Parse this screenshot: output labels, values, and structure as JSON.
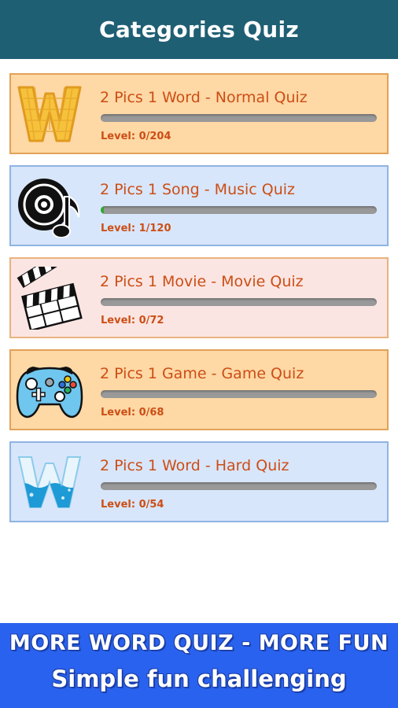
{
  "header": {
    "title": "Categories Quiz"
  },
  "categories": [
    {
      "title": "2 Pics 1 Word - Normal Quiz",
      "level": "Level: 0/204",
      "progress": 0.0,
      "theme": "orange",
      "icon": "waffle-w-icon"
    },
    {
      "title": "2 Pics 1 Song - Music Quiz",
      "level": "Level: 1/120",
      "progress": 0.0083,
      "theme": "blue",
      "icon": "vinyl-music-icon"
    },
    {
      "title": "2 Pics 1 Movie - Movie Quiz",
      "level": "Level: 0/72",
      "progress": 0.0,
      "theme": "pink",
      "icon": "clapperboard-icon"
    },
    {
      "title": "2 Pics 1 Game - Game Quiz",
      "level": "Level: 0/68",
      "progress": 0.0,
      "theme": "orange",
      "icon": "gamepad-icon"
    },
    {
      "title": "2 Pics 1 Word - Hard Quiz",
      "level": "Level: 0/54",
      "progress": 0.0,
      "theme": "blue",
      "icon": "water-w-icon"
    }
  ],
  "banner": {
    "line1": "MORE WORD QUIZ - MORE FUN",
    "line2": "Simple fun challenging"
  },
  "colors": {
    "header": "#1f5f73",
    "title_text": "#cc4e15",
    "progress_fill": "#2eaa2e",
    "banner": "#2962ee"
  }
}
